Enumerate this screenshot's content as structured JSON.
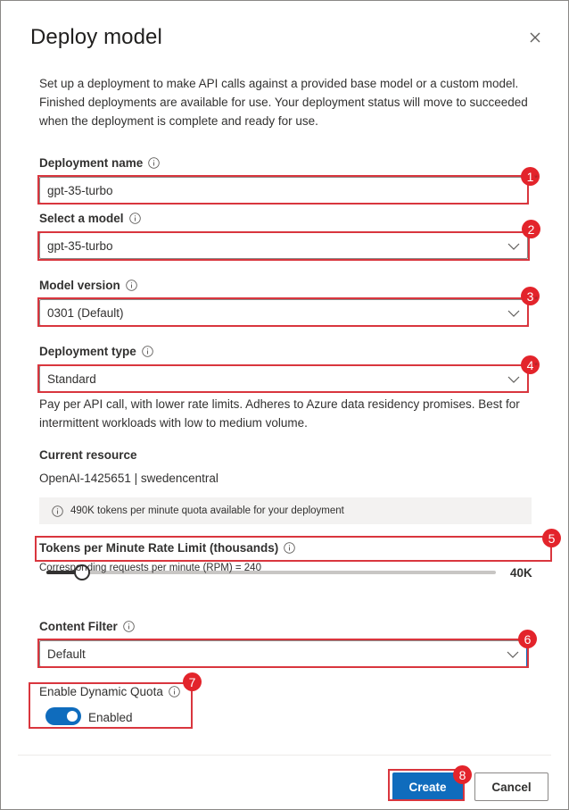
{
  "dialog": {
    "title": "Deploy model",
    "description": "Set up a deployment to make API calls against a provided base model or a custom model. Finished deployments are available for use. Your deployment status will move to succeeded when the deployment is complete and ready for use."
  },
  "fields": {
    "deployment_name": {
      "label": "Deployment name",
      "value": "gpt-35-turbo"
    },
    "select_model": {
      "label": "Select a model",
      "value": "gpt-35-turbo"
    },
    "model_version": {
      "label": "Model version",
      "value": "0301 (Default)"
    },
    "deployment_type": {
      "label": "Deployment type",
      "value": "Standard",
      "helper": "Pay per API call, with lower rate limits. Adheres to Azure data residency promises. Best for intermittent workloads with low to medium volume."
    },
    "current_resource": {
      "label": "Current resource",
      "value": "OpenAI-1425651 | swedencentral"
    },
    "quota_info": "490K tokens per minute quota available for your deployment",
    "rate_limit": {
      "label": "Tokens per Minute Rate Limit (thousands)",
      "value_label": "40K",
      "value": 40,
      "rpm_text": "Corresponding requests per minute (RPM) = 240"
    },
    "content_filter": {
      "label": "Content Filter",
      "value": "Default"
    },
    "dynamic_quota": {
      "label": "Enable Dynamic Quota",
      "toggle_label": "Enabled",
      "enabled": true
    }
  },
  "buttons": {
    "create": "Create",
    "cancel": "Cancel"
  },
  "annotations": [
    "1",
    "2",
    "3",
    "4",
    "5",
    "6",
    "7",
    "8"
  ],
  "required_marker": "*",
  "colors": {
    "accent": "#0f6cbd",
    "annotation": "#e3242b"
  }
}
